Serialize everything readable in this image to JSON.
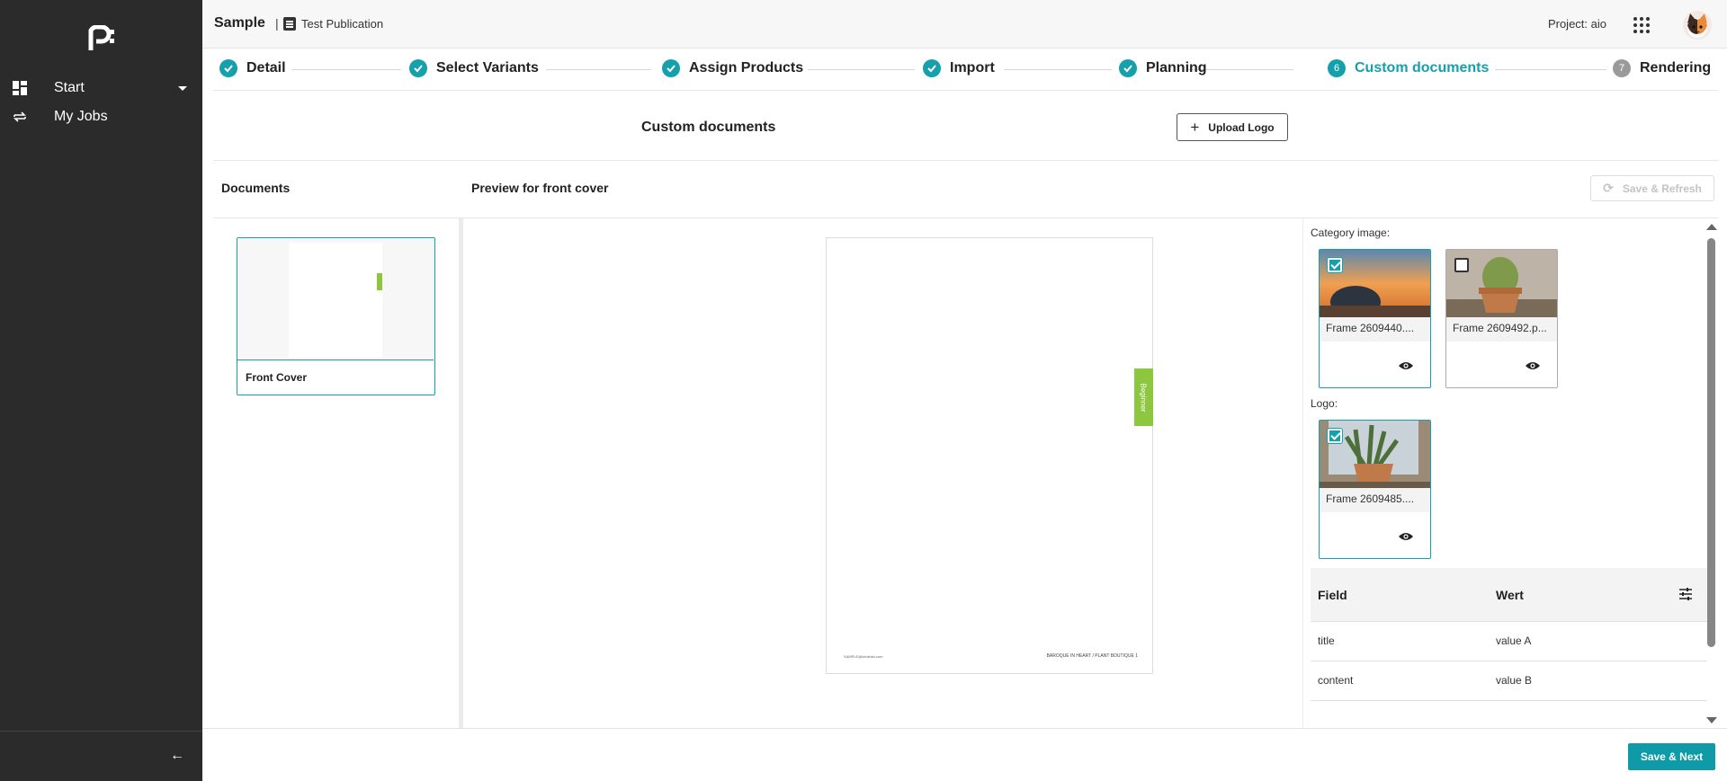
{
  "sidebar": {
    "items": [
      {
        "label": "Start",
        "icon": "dashboard-icon"
      },
      {
        "label": "My Jobs",
        "icon": "repeat-icon"
      }
    ]
  },
  "topbar": {
    "title": "Sample",
    "separator": "|",
    "publication": "Test Publication",
    "project": "Project: aio"
  },
  "stepper": {
    "steps": [
      {
        "label": "Detail",
        "state": "done"
      },
      {
        "label": "Select Variants",
        "state": "done"
      },
      {
        "label": "Assign Products",
        "state": "done"
      },
      {
        "label": "Import",
        "state": "done"
      },
      {
        "label": "Planning",
        "state": "done"
      },
      {
        "label": "Custom documents",
        "state": "active",
        "number": "6"
      },
      {
        "label": "Rendering",
        "state": "pending",
        "number": "7"
      }
    ]
  },
  "header": {
    "title": "Custom documents",
    "upload_label": "Upload Logo"
  },
  "panels": {
    "documents_title": "Documents",
    "preview_title": "Preview for front cover",
    "save_refresh_label": "Save & Refresh"
  },
  "documents": [
    {
      "name": "Front Cover"
    }
  ],
  "preview": {
    "tag": "Beginner",
    "footer_left": "SAMPLE@infolinks.com",
    "footer_right": "BAROQUE IN HEART / PLANT BOUTIQUE   1"
  },
  "options": {
    "category_label": "Category image:",
    "category_images": [
      {
        "name": "Frame 2609440....",
        "checked": true
      },
      {
        "name": "Frame 2609492.p...",
        "checked": false
      }
    ],
    "logo_label": "Logo:",
    "logo_images": [
      {
        "name": "Frame 2609485....",
        "checked": true
      }
    ]
  },
  "table": {
    "headers": [
      "Field",
      "Wert"
    ],
    "rows": [
      [
        "title",
        "value A"
      ],
      [
        "content",
        "value B"
      ]
    ]
  },
  "footer": {
    "save_next_label": "Save & Next"
  },
  "colors": {
    "accent": "#15a0ac",
    "sidebar": "#2b2b2b",
    "tag_green": "#8dc63f"
  }
}
